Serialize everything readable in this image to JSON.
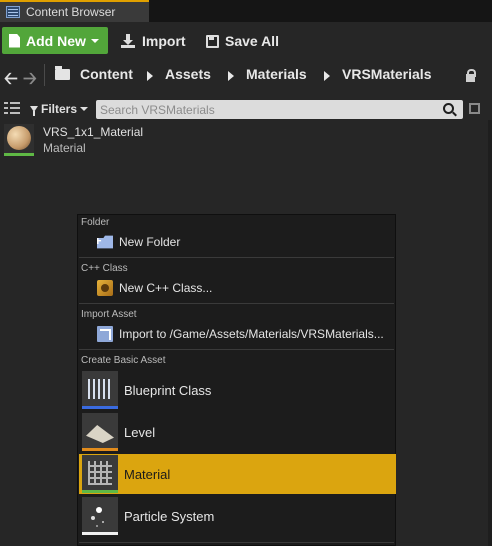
{
  "window": {
    "tab_title": "Content Browser"
  },
  "toolbar": {
    "add_new_label": "Add New",
    "import_label": "Import",
    "save_all_label": "Save All",
    "add_new_color": "#52a63a"
  },
  "path": {
    "crumbs": [
      "Content",
      "Assets",
      "Materials",
      "VRSMaterials"
    ]
  },
  "filters": {
    "filters_label": "Filters",
    "search_placeholder": "Search VRSMaterials"
  },
  "assets": [
    {
      "name": "VRS_1x1_Material",
      "type": "Material",
      "icon": "material-sphere-thumbnail"
    }
  ],
  "menu": {
    "sections": [
      {
        "header": "Folder",
        "items": [
          {
            "label": "New Folder",
            "icon": "new-folder-icon"
          }
        ]
      },
      {
        "header": "C++ Class",
        "items": [
          {
            "label": "New C++ Class...",
            "icon": "cpp-class-icon"
          }
        ]
      },
      {
        "header": "Import Asset",
        "items": [
          {
            "label": "Import to /Game/Assets/Materials/VRSMaterials...",
            "icon": "import-icon"
          }
        ]
      },
      {
        "header": "Create Basic Asset",
        "items": [
          {
            "label": "Blueprint Class",
            "icon": "blueprint-class-icon"
          },
          {
            "label": "Level",
            "icon": "level-icon"
          },
          {
            "label": "Material",
            "icon": "material-icon",
            "selected": true
          },
          {
            "label": "Particle System",
            "icon": "particle-system-icon"
          }
        ]
      }
    ],
    "highlight_color": "#dba50f"
  }
}
